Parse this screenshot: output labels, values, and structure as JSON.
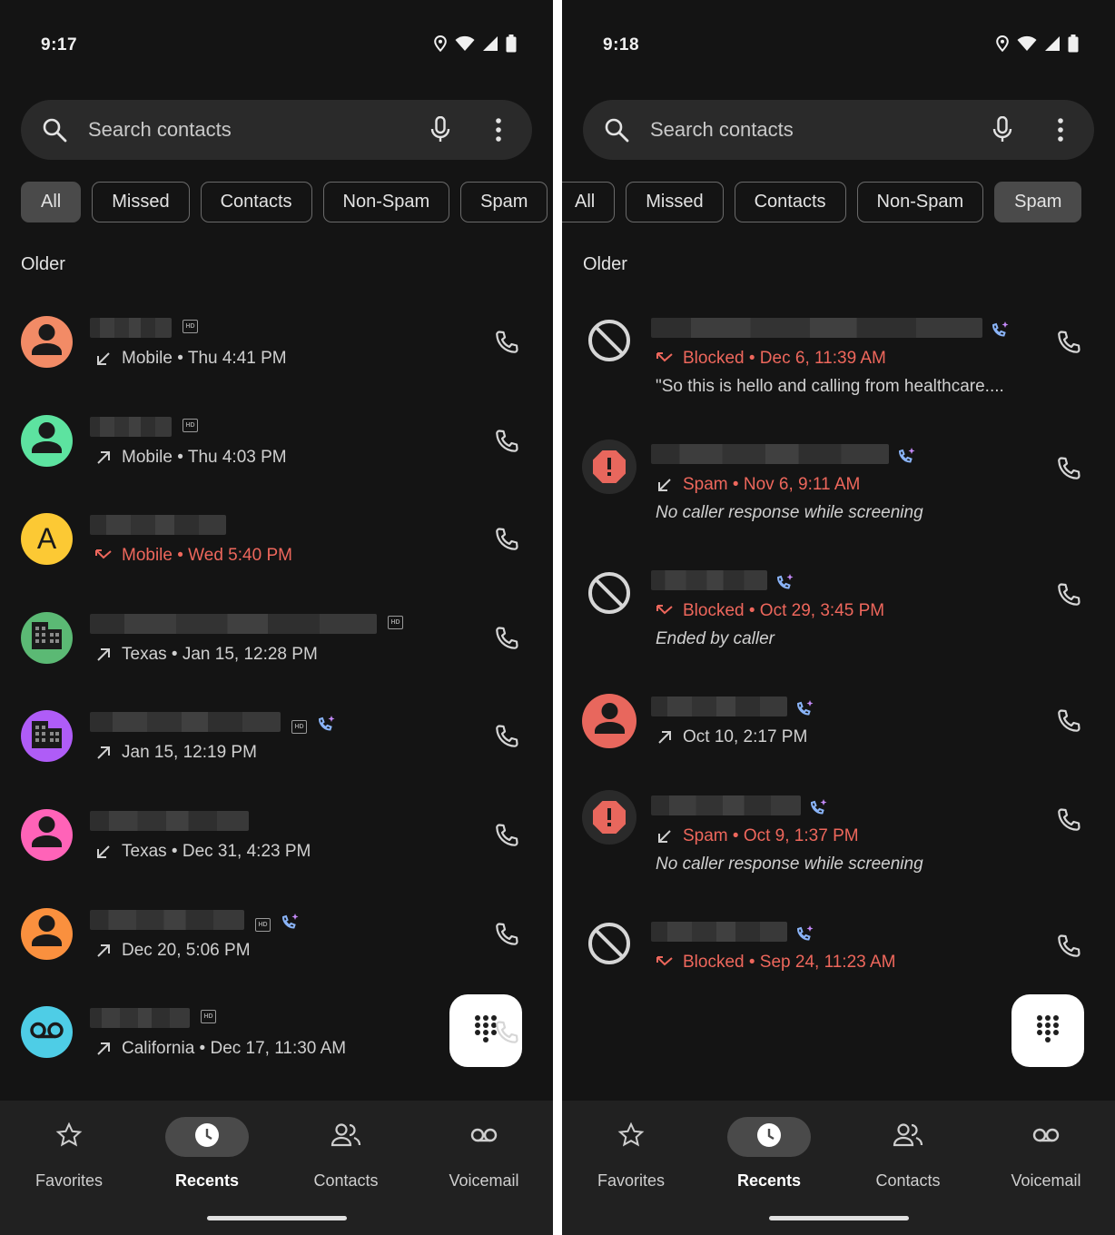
{
  "left": {
    "time": "9:17",
    "search_placeholder": "Search contacts",
    "chips": [
      "All",
      "Missed",
      "Contacts",
      "Non-Spam",
      "Spam"
    ],
    "active_chip": "All",
    "section": "Older",
    "calls": [
      {
        "avatar": "person",
        "color": "#f28b66",
        "bar_width": 90,
        "hd": true,
        "screen": false,
        "direction": "incoming",
        "detail": "Mobile • Thu 4:41 PM",
        "missed": false
      },
      {
        "avatar": "person",
        "color": "#5de3a0",
        "bar_width": 90,
        "hd": true,
        "screen": false,
        "direction": "outgoing",
        "detail": "Mobile • Thu 4:03 PM",
        "missed": false
      },
      {
        "avatar": "letter",
        "letter": "A",
        "color": "#fcc934",
        "bar_width": 150,
        "hd": false,
        "screen": false,
        "direction": "missed",
        "detail": "Mobile • Wed 5:40 PM",
        "missed": true
      },
      {
        "avatar": "business",
        "color": "#5bb974",
        "bar_width": 316,
        "hd": true,
        "screen": false,
        "direction": "outgoing",
        "detail": "Texas • Jan 15, 12:28 PM",
        "missed": false
      },
      {
        "avatar": "business",
        "color": "#af5cf7",
        "bar_width": 210,
        "hd": true,
        "screen": true,
        "direction": "outgoing",
        "detail": "Jan 15, 12:19 PM",
        "missed": false
      },
      {
        "avatar": "person",
        "color": "#ff63b8",
        "bar_width": 175,
        "hd": false,
        "screen": false,
        "direction": "incoming",
        "detail": "Texas • Dec 31, 4:23 PM",
        "missed": false
      },
      {
        "avatar": "person",
        "color": "#fa903e",
        "bar_width": 170,
        "hd": true,
        "screen": true,
        "direction": "outgoing",
        "detail": "Dec 20, 5:06 PM",
        "missed": false
      },
      {
        "avatar": "voicemail",
        "color": "#4ecde6",
        "bar_width": 110,
        "hd": true,
        "screen": false,
        "direction": "outgoing",
        "detail": "California • Dec 17, 11:30 AM",
        "missed": false
      }
    ]
  },
  "right": {
    "time": "9:18",
    "search_placeholder": "Search contacts",
    "chips": [
      "All",
      "Missed",
      "Contacts",
      "Non-Spam",
      "Spam"
    ],
    "active_chip": "Spam",
    "section": "Older",
    "calls": [
      {
        "type": "blocked",
        "bar_width": 365,
        "direction": "missed",
        "detail": "Blocked • Dec 6, 11:39 AM",
        "sub": "\"So this is hello and calling from healthcare....",
        "sub_italic": false
      },
      {
        "type": "spam",
        "bar_width": 262,
        "direction": "incoming",
        "detail": "Spam • Nov 6, 9:11 AM",
        "sub": "No caller response while screening",
        "sub_italic": true
      },
      {
        "type": "blocked",
        "bar_width": 128,
        "direction": "missed",
        "detail": "Blocked • Oct 29, 3:45 PM",
        "sub": "Ended by caller",
        "sub_italic": true
      },
      {
        "type": "person",
        "bar_width": 150,
        "direction": "outgoing",
        "detail": "Oct 10, 2:17 PM",
        "sub": "",
        "sub_italic": false
      },
      {
        "type": "spam",
        "bar_width": 165,
        "direction": "incoming",
        "detail": "Spam • Oct 9, 1:37 PM",
        "sub": "No caller response while screening",
        "sub_italic": true
      },
      {
        "type": "blocked",
        "bar_width": 150,
        "direction": "missed",
        "detail": "Blocked • Sep 24, 11:23 AM",
        "sub": "",
        "sub_italic": false
      }
    ]
  },
  "nav": [
    {
      "label": "Favorites",
      "icon": "star-icon"
    },
    {
      "label": "Recents",
      "icon": "clock-icon"
    },
    {
      "label": "Contacts",
      "icon": "people-icon"
    },
    {
      "label": "Voicemail",
      "icon": "voicemail-icon"
    }
  ],
  "active_nav": "Recents",
  "colors": {
    "missed_red": "#ee675c",
    "spam_avatar": "#e8675d",
    "background": "#141414"
  }
}
